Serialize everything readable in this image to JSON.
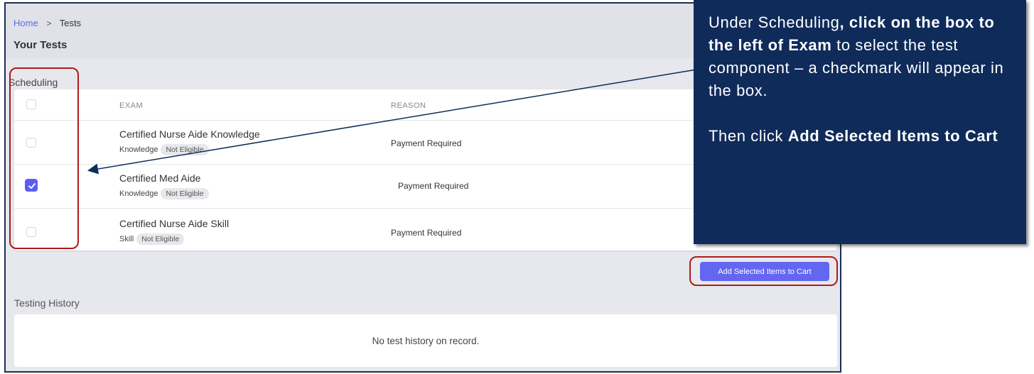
{
  "breadcrumb": {
    "home": "Home",
    "separator": ">",
    "current": "Tests"
  },
  "page_title": "Your Tests",
  "scheduling": {
    "label": "Scheduling",
    "columns": {
      "exam": "EXAM",
      "reason": "REASON"
    },
    "rows": [
      {
        "exam": "Certified Nurse Aide Knowledge",
        "type": "Knowledge",
        "status": "Not Eligible",
        "reason": "Payment Required",
        "checked": false
      },
      {
        "exam": "Certified Med Aide",
        "type": "Knowledge",
        "status": "Not Eligible",
        "reason": "Payment Required",
        "checked": true
      },
      {
        "exam": "Certified Nurse Aide Skill",
        "type": "Skill",
        "status": "Not Eligible",
        "reason": "Payment Required",
        "checked": false
      }
    ],
    "add_button": "Add Selected Items to Cart"
  },
  "history": {
    "label": "Testing History",
    "empty_text": "No test history on record."
  },
  "callout": {
    "line1_pre": "Under Scheduling",
    "line1_bold": ", click on the box to the left of Exam",
    "line1_post": " to select the test component – a checkmark will appear in the box.",
    "line2_pre": "Then click ",
    "line2_bold": "Add Selected Items to Cart"
  },
  "colors": {
    "accent": "#6366f1",
    "callout_bg": "#0f2b5a",
    "bracket": "#b01a1a"
  },
  "icons": {
    "checkmark": "checkmark-icon",
    "chevron": "chevron-right-icon",
    "arrow": "arrow-icon"
  }
}
